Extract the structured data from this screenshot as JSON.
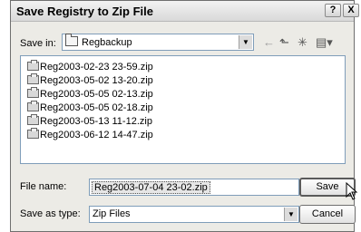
{
  "window": {
    "title": "Save Registry to Zip File",
    "help_label": "?",
    "close_label": "X"
  },
  "save_in": {
    "label": "Save in:",
    "value": "Regbackup"
  },
  "toolbar": {
    "back_icon": "←",
    "up_icon": "⬑",
    "new_folder_icon": "✳",
    "view_icon": "▤▾"
  },
  "files": [
    {
      "name": "Reg2003-02-23 23-59.zip"
    },
    {
      "name": "Reg2003-05-02 13-20.zip"
    },
    {
      "name": "Reg2003-05-05 02-13.zip"
    },
    {
      "name": "Reg2003-05-05 02-18.zip"
    },
    {
      "name": "Reg2003-05-13 11-12.zip"
    },
    {
      "name": "Reg2003-06-12 14-47.zip"
    }
  ],
  "file_name": {
    "label": "File name:",
    "value": "Reg2003-07-04 23-02.zip"
  },
  "save_as_type": {
    "label": "Save as type:",
    "value": "Zip Files"
  },
  "buttons": {
    "save": "Save",
    "cancel": "Cancel"
  }
}
